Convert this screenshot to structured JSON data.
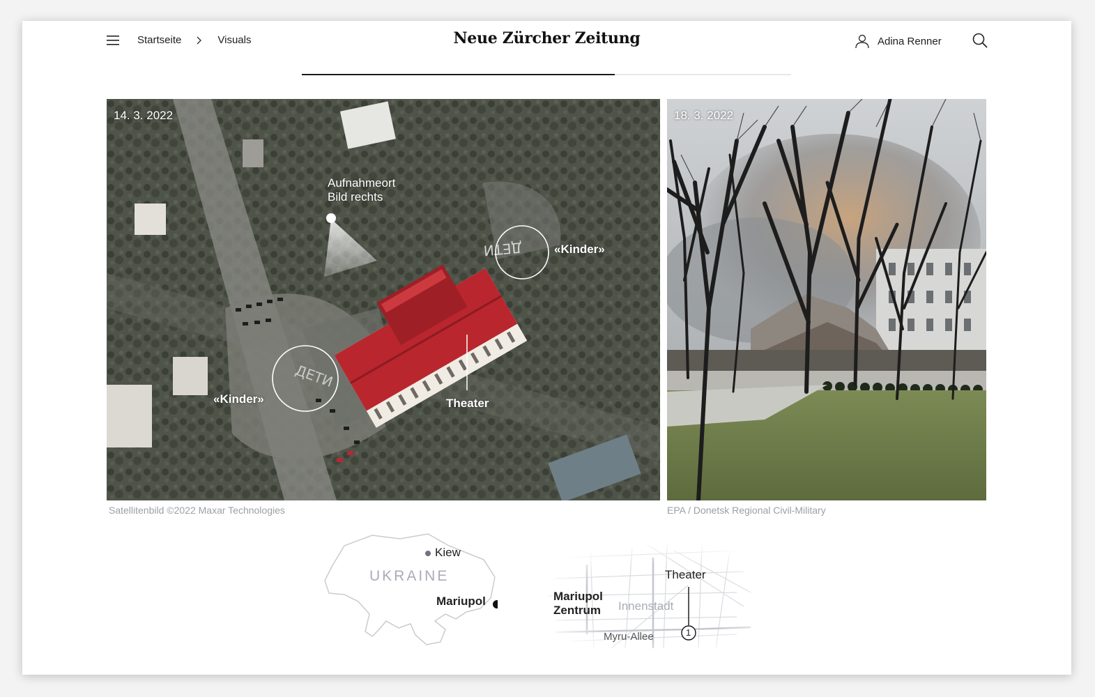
{
  "header": {
    "breadcrumb": [
      {
        "label": "Startseite"
      },
      {
        "label": "Visuals"
      }
    ],
    "logo_text": "Neue Zürcher Zeitung",
    "user_name": "Adina Renner",
    "reading_progress": 0.64
  },
  "satellite": {
    "date": "14. 3. 2022",
    "credit": "Satellitenbild ©2022 Maxar Technologies",
    "annotations": {
      "camera_line1": "Aufnahmeort",
      "camera_line2": "Bild rechts",
      "kinder_top": "«Kinder»",
      "kinder_left": "«Kinder»",
      "theater": "Theater"
    }
  },
  "photo": {
    "date": "18. 3. 2022",
    "credit": "EPA / Donetsk Regional Civil-Military"
  },
  "locator_map": {
    "country": "UKRAINE",
    "kiew": "Kiew",
    "mariupol": "Mariupol"
  },
  "city_map": {
    "theater": "Theater",
    "title_line1": "Mariupol",
    "title_line2": "Zentrum",
    "district": "Innenstadt",
    "street": "Myru-Allee",
    "marker": "1"
  },
  "colors": {
    "roof_red": "#b9262e",
    "credit_gray": "#9aa0a6",
    "map_outline": "#c9cbd1",
    "map_label": "#a9acb5"
  }
}
